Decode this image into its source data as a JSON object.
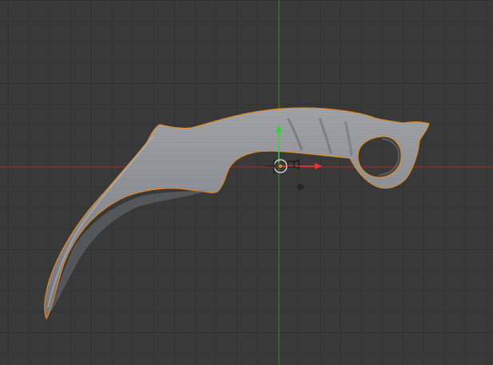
{
  "app": {
    "view": "3d-viewport",
    "mode": "object-mode",
    "background_color": "#393939",
    "grid_color": "#323232",
    "x_axis_color": "#a03232",
    "y_axis_color": "#44883a"
  },
  "scene_object": {
    "kind": "karambit-knife-mesh",
    "selected": true,
    "outline_color": "#e08a2a",
    "surface_color": "#8c8e93"
  },
  "gizmo": {
    "type": "translate-manipulator",
    "x_arrow_color": "#e83434",
    "y_arrow_color": "#3ad03a",
    "icons": [
      "camera-icon",
      "lamp-icon",
      "origin-point-icon"
    ]
  }
}
